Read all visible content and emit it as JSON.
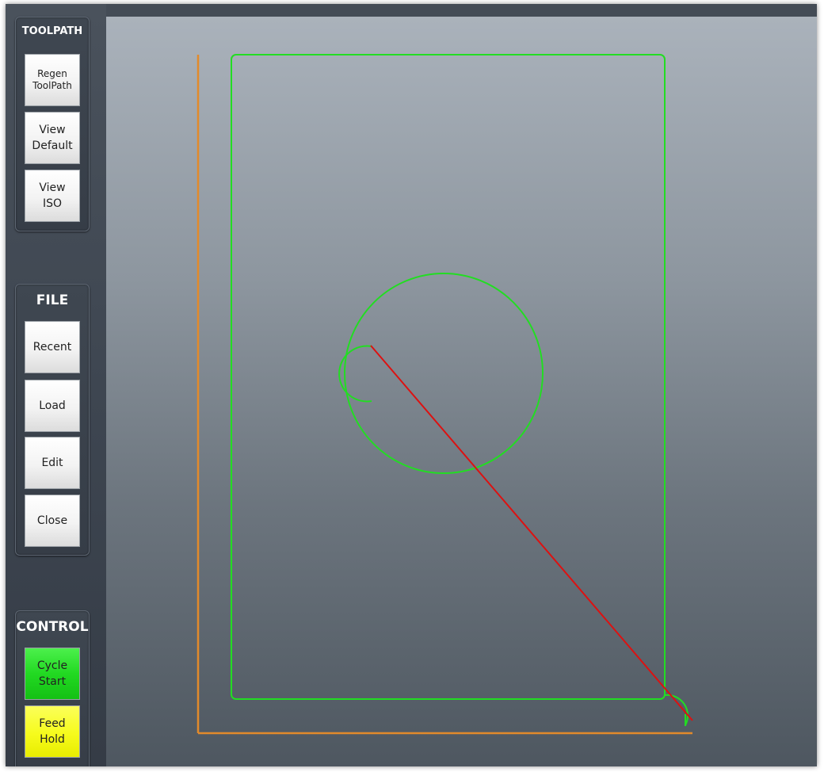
{
  "sidebar": {
    "toolpath": {
      "title": "TOOLPATH",
      "buttons": [
        {
          "label": "Regen\nToolPath"
        },
        {
          "label": "View\nDefault"
        },
        {
          "label": "View\nISO"
        }
      ]
    },
    "file": {
      "title": "FILE",
      "buttons": [
        {
          "label": "Recent"
        },
        {
          "label": "Load"
        },
        {
          "label": "Edit"
        },
        {
          "label": "Close"
        }
      ]
    },
    "control": {
      "title": "CONTROL",
      "buttons": [
        {
          "label": "Cycle\nStart"
        },
        {
          "label": "Feed\nHold"
        }
      ]
    }
  },
  "colors": {
    "axis": "#e28a2b",
    "toolpath": "#22dd22",
    "rapid_move": "#dd1111",
    "cycle_start": "#22d922",
    "feed_hold": "#f6fb1c"
  }
}
